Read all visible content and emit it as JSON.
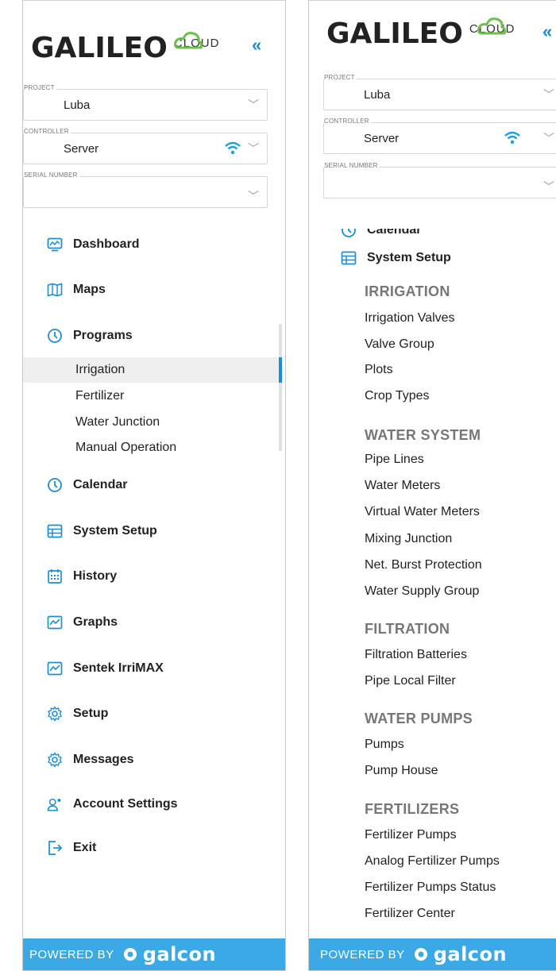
{
  "logo": {
    "brand": "GALILEO",
    "cloud": "CLOUD",
    "collapse": "«"
  },
  "fields": {
    "project": {
      "label": "PROJECT",
      "value": "Luba"
    },
    "controller": {
      "label": "CONTROLLER",
      "value": "Server"
    },
    "serial": {
      "label": "SERIAL NUMBER",
      "value": ""
    }
  },
  "left_menu": {
    "dashboard": "Dashboard",
    "maps": "Maps",
    "programs": "Programs",
    "programs_sub": [
      "Irrigation",
      "Fertilizer",
      "Water Junction",
      "Manual Operation"
    ],
    "calendar": "Calendar",
    "system_setup": "System Setup",
    "history": "History",
    "graphs": "Graphs",
    "sentek": "Sentek IrriMAX",
    "setup": "Setup",
    "messages": "Messages",
    "account_settings": "Account Settings",
    "exit": "Exit"
  },
  "right_menu": {
    "calendar": "Calendar",
    "system_setup": "System Setup",
    "irrigation": {
      "title": "IRRIGATION",
      "items": [
        "Irrigation Valves",
        "Valve Group",
        "Plots",
        "Crop Types"
      ]
    },
    "water_system": {
      "title": "WATER SYSTEM",
      "items": [
        "Pipe Lines",
        "Water Meters",
        "Virtual Water Meters",
        "Mixing Junction",
        "Net. Burst Protection",
        "Water Supply Group"
      ]
    },
    "filtration": {
      "title": "FILTRATION",
      "items": [
        "Filtration Batteries",
        "Pipe Local Filter"
      ]
    },
    "water_pumps": {
      "title": "WATER PUMPS",
      "items": [
        "Pumps",
        "Pump House"
      ]
    },
    "fertilizers": {
      "title": "FERTILIZERS",
      "items": [
        "Fertilizer Pumps",
        "Analog Fertilizer Pumps",
        "Fertilizer Pumps Status",
        "Fertilizer Center"
      ]
    }
  },
  "footer": {
    "powered_by": "POWERED BY",
    "brand": "galcon"
  },
  "colors": {
    "accent": "#1a8fd6",
    "footer": "#3aa9e6",
    "wifi": "#1aa0dd"
  }
}
